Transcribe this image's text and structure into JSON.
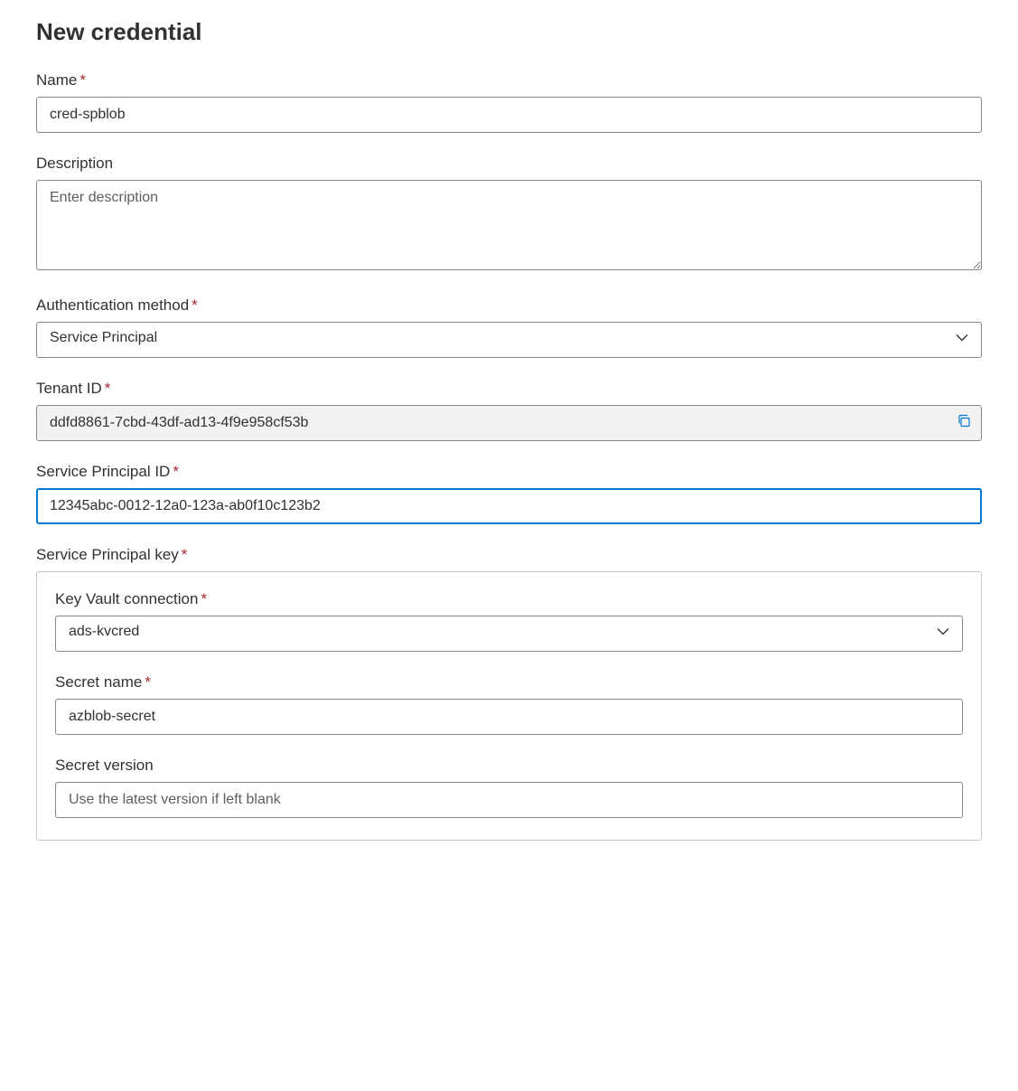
{
  "page": {
    "title": "New credential"
  },
  "fields": {
    "name": {
      "label": "Name",
      "value": "cred-spblob",
      "required": true
    },
    "description": {
      "label": "Description",
      "placeholder": "Enter description",
      "value": "",
      "required": false
    },
    "authMethod": {
      "label": "Authentication method",
      "value": "Service Principal",
      "required": true
    },
    "tenantId": {
      "label": "Tenant ID",
      "value": "ddfd8861-7cbd-43df-ad13-4f9e958cf53b",
      "required": true
    },
    "spId": {
      "label": "Service Principal ID",
      "value": "12345abc-0012-12a0-123a-ab0f10c123b2",
      "required": true
    },
    "spKey": {
      "label": "Service Principal key",
      "required": true,
      "kvConnection": {
        "label": "Key Vault connection",
        "value": "ads-kvcred",
        "required": true
      },
      "secretName": {
        "label": "Secret name",
        "value": "azblob-secret",
        "required": true
      },
      "secretVersion": {
        "label": "Secret version",
        "placeholder": "Use the latest version if left blank",
        "value": "",
        "required": false
      }
    }
  }
}
